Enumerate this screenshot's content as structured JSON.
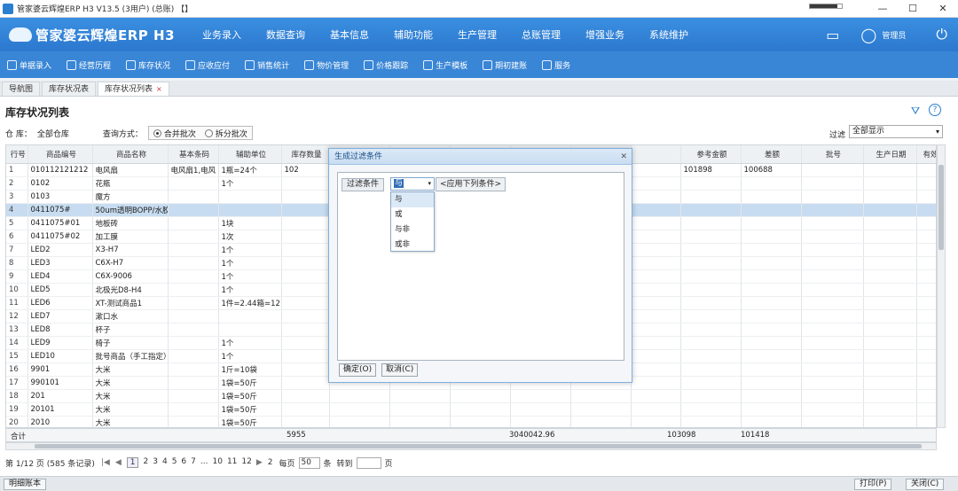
{
  "window": {
    "title": "管家婆云辉煌ERP H3 V13.5  (3用户)  (总账)  【】",
    "btn_min": "—",
    "btn_max": "☐",
    "btn_close": "✕",
    "progress_fraction": 0.85
  },
  "header": {
    "logo": "管家婆云辉煌ERP H3",
    "menu": [
      "业务录入",
      "数据查询",
      "基本信息",
      "辅助功能",
      "生产管理",
      "总账管理",
      "增强业务",
      "系统维护"
    ],
    "user": "管理员"
  },
  "toolbar": [
    "单据录入",
    "经营历程",
    "库存状况",
    "应收应付",
    "销售统计",
    "物价管理",
    "价格跟踪",
    "生产模板",
    "期初建账",
    "服务"
  ],
  "tabs": [
    {
      "label": "导航图"
    },
    {
      "label": "库存状况表"
    },
    {
      "label": "库存状况列表",
      "close": "×"
    }
  ],
  "page": {
    "title": "库存状况列表",
    "warehouse_label": "仓 库：",
    "warehouse_value": "全部仓库",
    "query_label": "查询方式：",
    "radio_merge": "合并批次",
    "radio_split": "拆分批次",
    "filter_label": "过滤",
    "filter_value": "全部显示"
  },
  "table": {
    "headers": [
      "行号",
      "商品编号",
      "商品名称",
      "基本条码",
      "辅助单位",
      "库存数量",
      "",
      "",
      "",
      "",
      "",
      "",
      "参考金额",
      "差额",
      "批号",
      "生产日期",
      "有效"
    ],
    "rows": [
      [
        "1",
        "010112121212",
        "电风扇",
        "电风扇1,电风",
        "1瓶=24个",
        "102",
        "",
        "",
        "",
        "",
        "",
        "",
        "101898",
        "100688",
        "",
        "",
        ""
      ],
      [
        "2",
        "0102",
        "花瓶",
        "",
        "1个",
        "",
        "",
        "",
        "",
        "",
        "",
        "",
        "",
        "",
        "",
        "",
        ""
      ],
      [
        "3",
        "0103",
        "魔方",
        "",
        "",
        "",
        "",
        "",
        "",
        "",
        "",
        "",
        "",
        "",
        "",
        "",
        ""
      ],
      [
        "4",
        "0411075#",
        "50um透明BOPP/水胶",
        "",
        "",
        "",
        "",
        "",
        "",
        "",
        "",
        "",
        "",
        "",
        "",
        "",
        ""
      ],
      [
        "5",
        "0411075#01",
        "地板砖",
        "",
        "1块",
        "",
        "",
        "",
        "",
        "",
        "",
        "",
        "",
        "",
        "",
        "",
        ""
      ],
      [
        "6",
        "0411075#02",
        "加工膜",
        "",
        "1次",
        "",
        "",
        "",
        "",
        "",
        "",
        "",
        "",
        "",
        "",
        "",
        ""
      ],
      [
        "7",
        "LED2",
        "X3-H7",
        "",
        "1个",
        "",
        "",
        "",
        "",
        "",
        "",
        "",
        "",
        "",
        "",
        "",
        ""
      ],
      [
        "8",
        "LED3",
        "C6X-H7",
        "",
        "1个",
        "",
        "",
        "",
        "",
        "",
        "",
        "",
        "",
        "",
        "",
        "",
        ""
      ],
      [
        "9",
        "LED4",
        "C6X-9006",
        "",
        "1个",
        "",
        "",
        "",
        "",
        "",
        "",
        "",
        "",
        "",
        "",
        "",
        ""
      ],
      [
        "10",
        "LED5",
        "北极光D8-H4",
        "",
        "1个",
        "",
        "",
        "",
        "",
        "",
        "",
        "",
        "",
        "",
        "",
        "",
        ""
      ],
      [
        "11",
        "LED6",
        "XT-测试商品1",
        "",
        "1件=2.44箱=12",
        "",
        "",
        "",
        "",
        "",
        "",
        "",
        "",
        "",
        "",
        "",
        ""
      ],
      [
        "12",
        "LED7",
        "漱口水",
        "",
        "",
        "",
        "",
        "",
        "",
        "",
        "",
        "",
        "",
        "",
        "",
        "",
        ""
      ],
      [
        "13",
        "LED8",
        "杯子",
        "",
        "",
        "",
        "",
        "",
        "",
        "",
        "",
        "",
        "",
        "",
        "",
        "",
        ""
      ],
      [
        "14",
        "LED9",
        "椅子",
        "",
        "1个",
        "",
        "",
        "",
        "",
        "",
        "",
        "",
        "",
        "",
        "",
        "",
        ""
      ],
      [
        "15",
        "LED10",
        "批号商品（手工指定）",
        "",
        "1个",
        "",
        "",
        "",
        "",
        "",
        "",
        "",
        "",
        "",
        "",
        "",
        ""
      ],
      [
        "16",
        "9901",
        "大米",
        "",
        "1斤=10袋",
        "",
        "",
        "",
        "",
        "",
        "",
        "",
        "",
        "",
        "",
        "",
        ""
      ],
      [
        "17",
        "990101",
        "大米",
        "",
        "1袋=50斤",
        "",
        "",
        "",
        "",
        "",
        "",
        "",
        "",
        "",
        "",
        "",
        ""
      ],
      [
        "18",
        "201",
        "大米",
        "",
        "1袋=50斤",
        "",
        "",
        "",
        "",
        "",
        "",
        "",
        "",
        "",
        "",
        "",
        ""
      ],
      [
        "19",
        "20101",
        "大米",
        "",
        "1袋=50斤",
        "",
        "",
        "",
        "",
        "",
        "",
        "",
        "",
        "",
        "",
        "",
        ""
      ],
      [
        "20",
        "2010",
        "大米",
        "",
        "1袋=50斤",
        "",
        "",
        "",
        "",
        "",
        "",
        "",
        "",
        "",
        "",
        "",
        ""
      ]
    ],
    "selected_row": 3
  },
  "totals": {
    "label": "合计",
    "qty": "5955",
    "amount": "3040042.96",
    "ref_amount": "103098",
    "diff": "101418"
  },
  "pager": {
    "info": "第 1/12 页 (585 条记录)",
    "first": "|◀",
    "prev": "◀",
    "pages": [
      "1",
      "2",
      "3",
      "4",
      "5",
      "6",
      "7",
      "...",
      "10",
      "11",
      "12"
    ],
    "next": "▶",
    "goto_page": "2",
    "per_page_label": "每页",
    "per_page_value": "50",
    "unit": "条",
    "jump_label": "转到",
    "page_unit": "页"
  },
  "status": {
    "left_btn": "明细账本",
    "print_btn": "打印(P)",
    "close_btn": "关闭(C)"
  },
  "dialog": {
    "title": "生成过滤条件",
    "close": "✕",
    "cond_button": "过滤条件",
    "select_value": "与",
    "apply_tag": "<应用下列条件>",
    "options": [
      "与",
      "或",
      "与非",
      "或非"
    ],
    "ok": "确定(O)",
    "cancel": "取消(C)"
  }
}
